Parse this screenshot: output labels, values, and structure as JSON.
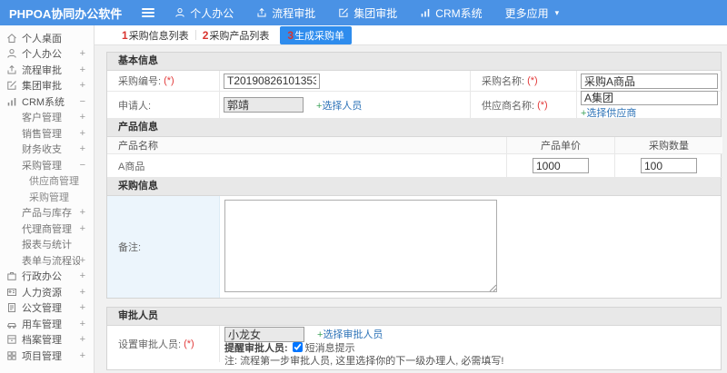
{
  "colors": {
    "topbar": "#4a92e5",
    "active_tab": "#2e8ced",
    "link": "#2f74b8",
    "plus_sign": "#3fa45b",
    "required": "#e23b3b",
    "remark_label_bg": "#ecf5fc"
  },
  "topbar": {
    "brand": "PHPOA协同办公软件",
    "menu_icon": "hamburger-icon",
    "nav": [
      {
        "icon": "user-icon",
        "label": "个人办公"
      },
      {
        "icon": "flow-icon",
        "label": "流程审批"
      },
      {
        "icon": "edit-icon",
        "label": "集团审批"
      },
      {
        "icon": "chart-icon",
        "label": "CRM系统"
      },
      {
        "icon": "",
        "label": "更多应用",
        "caret": true
      }
    ]
  },
  "sidebar": {
    "items": [
      {
        "level": 1,
        "icon": "home-icon",
        "label": "个人桌面",
        "expand": ""
      },
      {
        "level": 1,
        "icon": "user-icon",
        "label": "个人办公",
        "expand": "+"
      },
      {
        "level": 1,
        "icon": "flow-icon",
        "label": "流程审批",
        "expand": "+"
      },
      {
        "level": 1,
        "icon": "edit-icon",
        "label": "集团审批",
        "expand": "+"
      },
      {
        "level": 1,
        "icon": "chart-icon",
        "label": "CRM系统",
        "expand": "-"
      },
      {
        "level": 2,
        "icon": "",
        "label": "客户管理",
        "expand": "+"
      },
      {
        "level": 2,
        "icon": "",
        "label": "销售管理",
        "expand": "+"
      },
      {
        "level": 2,
        "icon": "",
        "label": "财务收支",
        "expand": "+"
      },
      {
        "level": 2,
        "icon": "",
        "label": "采购管理",
        "expand": "-"
      },
      {
        "level": 3,
        "icon": "",
        "label": "供应商管理",
        "expand": ""
      },
      {
        "level": 3,
        "icon": "",
        "label": "采购管理",
        "expand": ""
      },
      {
        "level": 2,
        "icon": "",
        "label": "产品与库存",
        "expand": "+"
      },
      {
        "level": 2,
        "icon": "",
        "label": "代理商管理",
        "expand": "+"
      },
      {
        "level": 2,
        "icon": "",
        "label": "报表与统计",
        "expand": ""
      },
      {
        "level": 2,
        "icon": "",
        "label": "表单与流程设置",
        "expand": "+"
      },
      {
        "level": 1,
        "icon": "org-icon",
        "label": "行政办公",
        "expand": "+"
      },
      {
        "level": 1,
        "icon": "hr-icon",
        "label": "人力资源",
        "expand": "+"
      },
      {
        "level": 1,
        "icon": "doc-icon",
        "label": "公文管理",
        "expand": "+"
      },
      {
        "level": 1,
        "icon": "car-icon",
        "label": "用车管理",
        "expand": "+"
      },
      {
        "level": 1,
        "icon": "archive-icon",
        "label": "档案管理",
        "expand": "+"
      },
      {
        "level": 1,
        "icon": "project-icon",
        "label": "项目管理",
        "expand": "+"
      }
    ]
  },
  "tabs": [
    {
      "num": "1",
      "label": "采购信息列表",
      "active": false
    },
    {
      "num": "2",
      "label": "采购产品列表",
      "active": false
    },
    {
      "num": "3",
      "label": "生成采购单",
      "active": true
    }
  ],
  "form": {
    "basic": {
      "title": "基本信息",
      "purchase_no": {
        "label": "采购编号:",
        "req": "(*)",
        "value": "T20190826101353"
      },
      "purchase_name": {
        "label": "采购名称:",
        "req": "(*)",
        "value": "采购A商品"
      },
      "applicant": {
        "label": "申请人:",
        "value": "郭靖",
        "link_plus": "+",
        "link_text": "选择人员"
      },
      "supplier": {
        "label": "供应商名称:",
        "req": "(*)",
        "value": "A集团",
        "link_plus": "+",
        "link_text": "选择供应商"
      }
    },
    "product": {
      "title": "产品信息",
      "headers": [
        "产品名称",
        "产品单价",
        "采购数量"
      ],
      "rows": [
        {
          "name": "A商品",
          "price": "1000",
          "qty": "100"
        }
      ]
    },
    "purchase_info": {
      "title": "采购信息",
      "remark_label": "备注:"
    },
    "approval": {
      "title": "审批人员",
      "set_label": "设置审批人员:",
      "req": "(*)",
      "approver": "小龙女",
      "link_plus": "+",
      "link_text": "选择审批人员",
      "remind_label": "提醒审批人员:",
      "sms_label": "短消息提示",
      "sms_checked": true,
      "note": "注: 流程第一步审批人员, 这里选择你的下一级办理人, 必需填写!"
    }
  }
}
